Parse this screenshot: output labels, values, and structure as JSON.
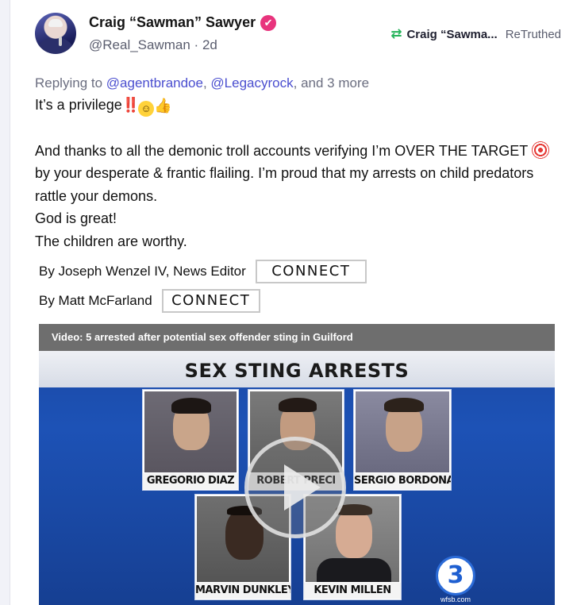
{
  "post": {
    "author_name": "Craig “Sawman” Sawyer",
    "verified_glyph": "✔",
    "handle": "@Real_Sawman",
    "separator": " · ",
    "time_ago": "2d",
    "retruth": {
      "icon": "retruth-icon",
      "name": "Craig “Sawma...",
      "label": "ReTruthed"
    },
    "reply": {
      "prefix": "Replying to ",
      "mention_1": "@agentbrandoe",
      "comma": ", ",
      "mention_2": "@Legacyrock",
      "suffix": ", and 3 more"
    },
    "text": {
      "line_1": "It’s a privilege",
      "bangs": "‼️",
      "face": "☺",
      "thumb": "👍",
      "para_2_a": "And thanks to all the demonic troll accounts verifying I’m OVER THE TARGET ",
      "para_2_b": " by your desperate & frantic flailing. I’m proud that my arrests on child predators rattle your demons.",
      "line_god": "God is great!",
      "line_children": "The children are worthy."
    }
  },
  "bylines": [
    {
      "text": "By Joseph Wenzel IV, News Editor",
      "button": "CONNECT"
    },
    {
      "text": "By Matt McFarland",
      "button": "CONNECT"
    }
  ],
  "video": {
    "title": "Video: 5 arrested after potential sex offender sting in Guilford",
    "banner": "SEX STING ARRESTS",
    "mugshots": [
      {
        "name": "GREGORIO DIAZ"
      },
      {
        "name": "ROBERT PRECI"
      },
      {
        "name": "SERGIO BORDONARO"
      },
      {
        "name": "MARVIN DUNKLEY"
      },
      {
        "name": "KEVIN MILLEN"
      }
    ],
    "logo_number": "3",
    "logo_sub": "wfsb.com"
  },
  "colors": {
    "verified": "#e8347d",
    "retruth_green": "#25b35a",
    "mention_link": "#4a4ecf",
    "video_blue": "#1d52b6"
  }
}
